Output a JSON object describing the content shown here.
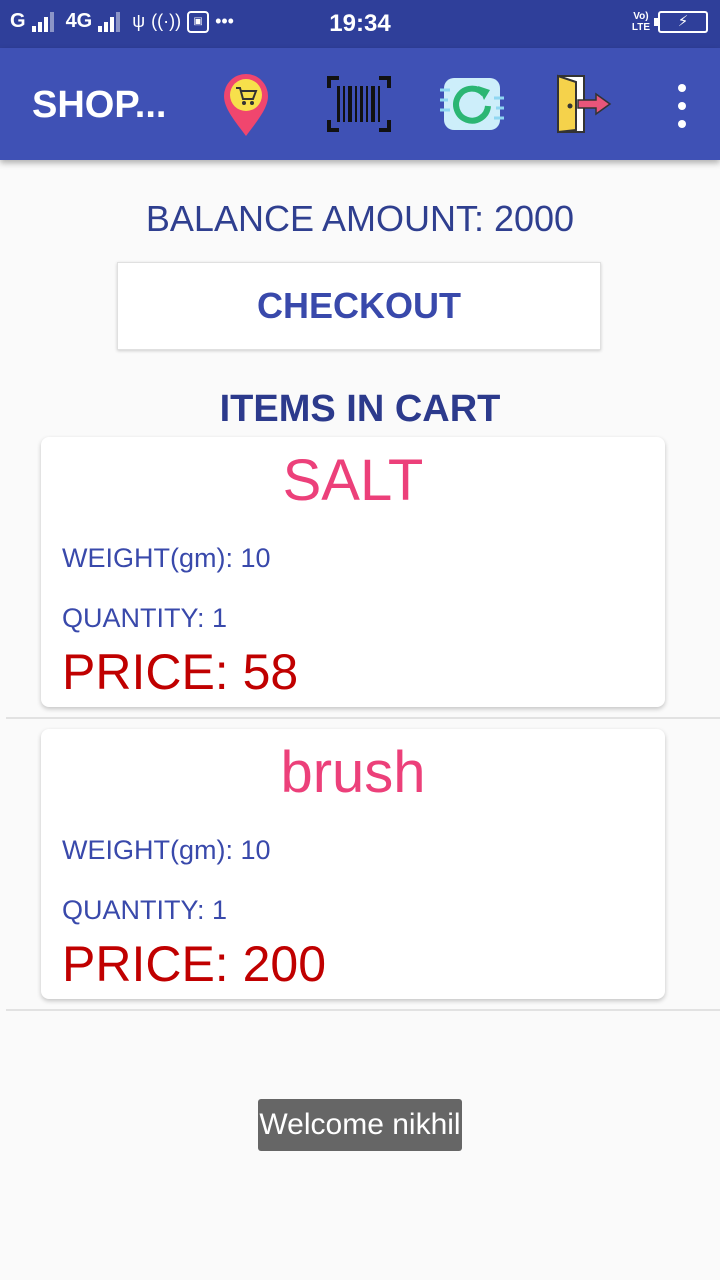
{
  "status_bar": {
    "network_g": "G",
    "network_4g": "4G",
    "time": "19:34",
    "volte_top": "Vo)",
    "volte_bottom": "LTE",
    "overflow": "•••"
  },
  "toolbar": {
    "title": "SHOP...",
    "icons": [
      "store-location-icon",
      "barcode-scanner-icon",
      "refresh-icon",
      "logout-door-icon",
      "more-vert-icon"
    ]
  },
  "balance": {
    "text": "BALANCE AMOUNT: 2000"
  },
  "checkout": {
    "label": "CHECKOUT"
  },
  "cart": {
    "heading": "ITEMS IN CART",
    "items": [
      {
        "name": "SALT",
        "weight": "WEIGHT(gm): 10",
        "quantity": "QUANTITY: 1",
        "price": "PRICE: 58"
      },
      {
        "name": "brush",
        "weight": "WEIGHT(gm): 10",
        "quantity": "QUANTITY: 1",
        "price": "PRICE: 200"
      }
    ]
  },
  "toast": {
    "text": "Welcome nikhil"
  },
  "colors": {
    "status_bar": "#2f3f9a",
    "toolbar": "#3f51b5",
    "item_name": "#ec407a",
    "price": "#c00000",
    "label": "#3949ab"
  }
}
